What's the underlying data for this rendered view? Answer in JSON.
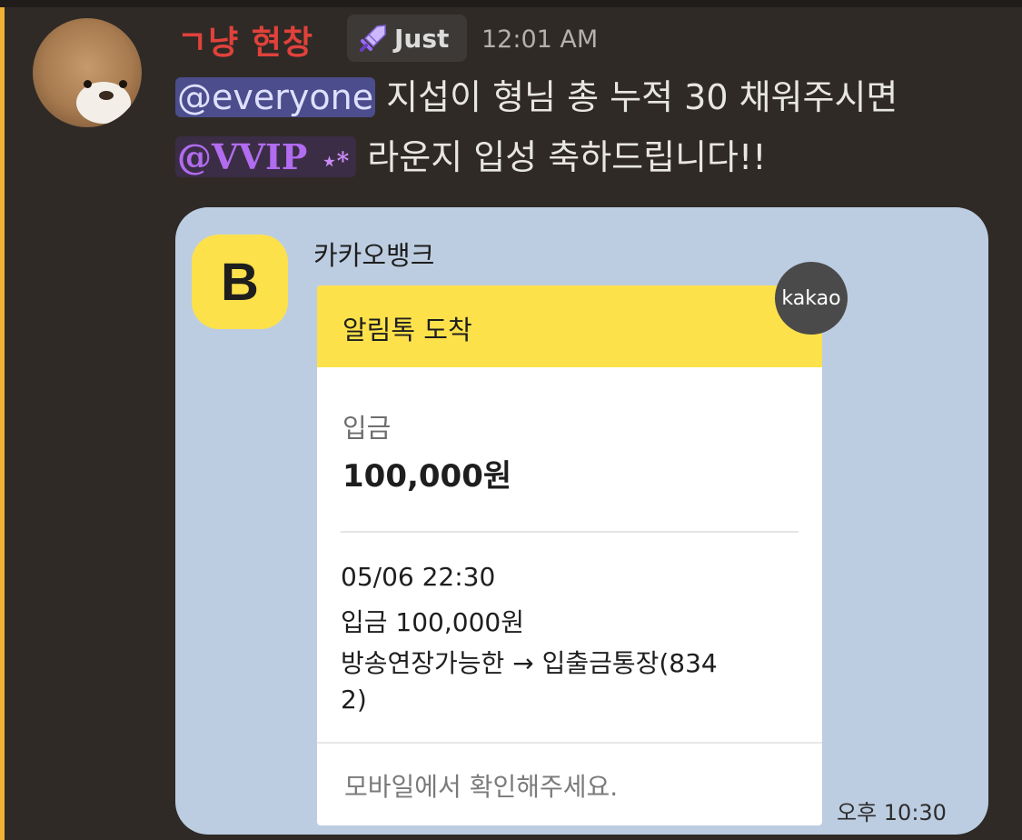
{
  "message": {
    "author": "ㄱ냥 현창",
    "role_badge": "Just",
    "role_icon": "sword-icon",
    "timestamp": "12:01 AM",
    "line1_mention": "@everyone",
    "line1_text": " 지섭이 형님 총 누적 30 채워주시면",
    "line2_mention": "@VVIP",
    "line2_sparkle": "⋆*",
    "line2_text": " 라운지 입성 축하드립니다!!",
    "colors": {
      "author": "#e0423b",
      "mention_line": "#f0b232",
      "everyone_bg": "#4b4d8c",
      "vvip": "#b16cf0"
    }
  },
  "card": {
    "bank_logo_letter": "B",
    "bank_name": "카카오뱅크",
    "kakao_badge": "kakao",
    "notice_title": "알림톡 도착",
    "deposit_label": "입금",
    "deposit_amount": "100,000원",
    "details": [
      "05/06 22:30",
      "입금 100,000원",
      "방송연장가능한 → 입출금통장(834",
      "2)"
    ],
    "footer": "모바일에서 확인해주세요.",
    "time": "오후 10:30",
    "colors": {
      "card_bg": "#bdcde1",
      "yellow": "#fde14b"
    }
  }
}
